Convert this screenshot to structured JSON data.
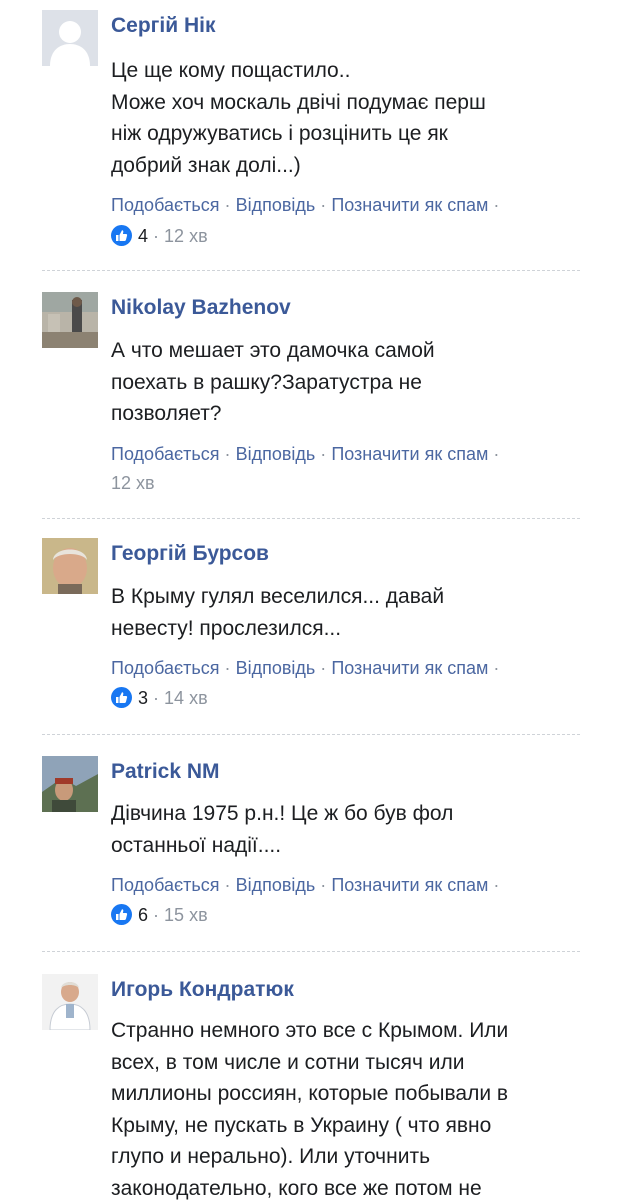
{
  "comments": [
    {
      "author": "Сергій Нік",
      "lines": [
        "Це ще кому пощастило..",
        "Може хоч москаль двічі подумає перш",
        "ніж одружуватись і розцінить це як",
        "добрий знак долі...)"
      ],
      "like_count": "4",
      "time": "12 хв"
    },
    {
      "author": "Nikolay Bazhenov",
      "lines": [
        "А что мешает это дамочка самой",
        "поехать в рашку?Заратустра не",
        "позволяет?"
      ],
      "time": "12 хв"
    },
    {
      "author": "Георгій Бурсов",
      "lines": [
        "В Крыму гулял веселился... давай",
        "невесту! прослезился..."
      ],
      "like_count": "3",
      "time": "14 хв"
    },
    {
      "author": "Patrick NM",
      "lines": [
        "Дівчина 1975 р.н.! Це ж бо був фол",
        "останньої надії...."
      ],
      "like_count": "6",
      "time": "15 хв"
    },
    {
      "author": "Игорь Кондратюк",
      "lines": [
        "Странно немного это все с Крымом. Или",
        "всех, в том числе и сотни тысяч или",
        "миллионы россиян, которые побывали в",
        "Крыму, не пускать в Украину ( что явно",
        "глупо и нерально). Или уточнить",
        "законодательно, кого все же потом не"
      ]
    }
  ],
  "actions": {
    "like": "Подобається",
    "reply": "Відповідь",
    "spam": "Позначити як спам",
    "separator": "·"
  },
  "colors": {
    "link": "#4b67a1",
    "author": "#3b5998",
    "like_badge": "#1877f2"
  }
}
